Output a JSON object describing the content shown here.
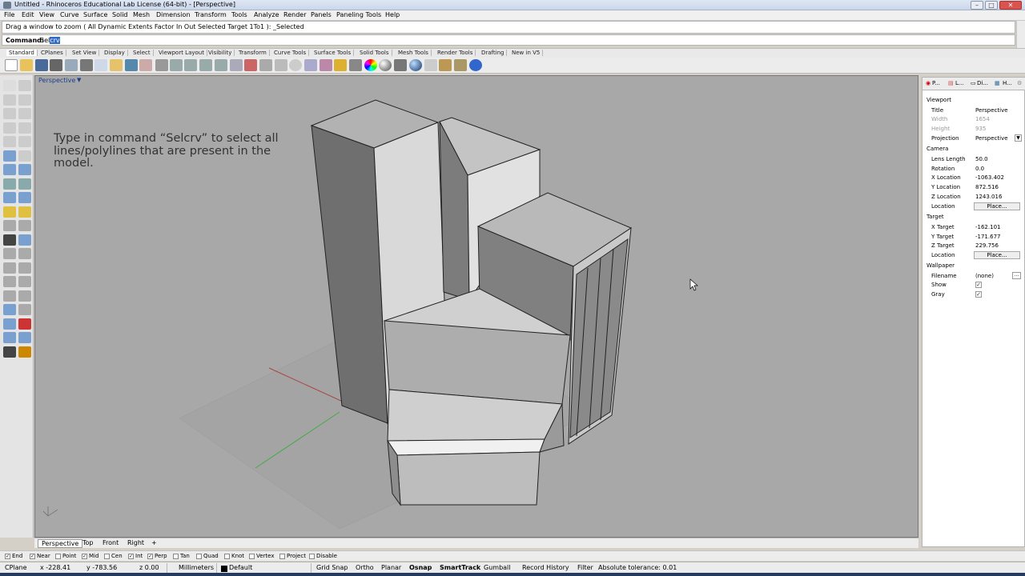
{
  "window": {
    "title": "Untitled - Rhinoceros Educational Lab License (64-bit) - [Perspective]"
  },
  "menu": [
    "File",
    "Edit",
    "View",
    "Curve",
    "Surface",
    "Solid",
    "Mesh",
    "Dimension",
    "Transform",
    "Tools",
    "Analyze",
    "Render",
    "Panels",
    "Paneling Tools",
    "Help"
  ],
  "command": {
    "history": "Drag a window to zoom ( All  Dynamic  Extents  Factor  In  Out  Selected  Target  1To1 ): _Selected",
    "label": "Command:",
    "typed_prefix": "Sel",
    "typed_selected": "crv"
  },
  "toolbar_tabs": [
    "Standard",
    "CPlanes",
    "Set View",
    "Display",
    "Select",
    "Viewport Layout",
    "Visibility",
    "Transform",
    "Curve Tools",
    "Surface Tools",
    "Solid Tools",
    "Mesh Tools",
    "Render Tools",
    "Drafting",
    "New in V5"
  ],
  "viewport": {
    "title": "Perspective",
    "annotation": "Type in command “Selcrv” to select all lines/polylines that are present in the model.",
    "tabs": [
      "Perspective",
      "Top",
      "Front",
      "Right"
    ]
  },
  "panel": {
    "tabs": [
      "P...",
      "L...",
      "Di...",
      "H..."
    ],
    "viewport_header": "Viewport",
    "title_label": "Title",
    "title_value": "Perspective",
    "width_label": "Width",
    "width_value": "1654",
    "height_label": "Height",
    "height_value": "935",
    "projection_label": "Projection",
    "projection_value": "Perspective",
    "camera_header": "Camera",
    "lens_label": "Lens Length",
    "lens_value": "50.0",
    "rotation_label": "Rotation",
    "rotation_value": "0.0",
    "xloc_label": "X Location",
    "xloc_value": "-1063.402",
    "yloc_label": "Y Location",
    "yloc_value": "872.516",
    "zloc_label": "Z Location",
    "zloc_value": "1243.016",
    "location_label": "Location",
    "place_button": "Place...",
    "target_header": "Target",
    "xtgt_label": "X Target",
    "xtgt_value": "-162.101",
    "ytgt_label": "Y Target",
    "ytgt_value": "-171.677",
    "ztgt_label": "Z Target",
    "ztgt_value": "229.756",
    "wallpaper_header": "Wallpaper",
    "filename_label": "Filename",
    "filename_value": "(none)",
    "show_label": "Show",
    "gray_label": "Gray"
  },
  "osnap": [
    "End",
    "Near",
    "Point",
    "Mid",
    "Cen",
    "Int",
    "Perp",
    "Tan",
    "Quad",
    "Knot",
    "Vertex",
    "Project",
    "Disable"
  ],
  "status": {
    "cplane": "CPlane",
    "x": "x -228.41",
    "y": "y -783.56",
    "z": "z 0.00",
    "units": "Millimeters",
    "layer": "Default",
    "grid_snap": "Grid Snap",
    "ortho": "Ortho",
    "planar": "Planar",
    "osnap": "Osnap",
    "smarttrack": "SmartTrack",
    "gumball": "Gumball",
    "record_history": "Record History",
    "filter": "Filter",
    "tolerance": "Absolute tolerance: 0.01"
  }
}
